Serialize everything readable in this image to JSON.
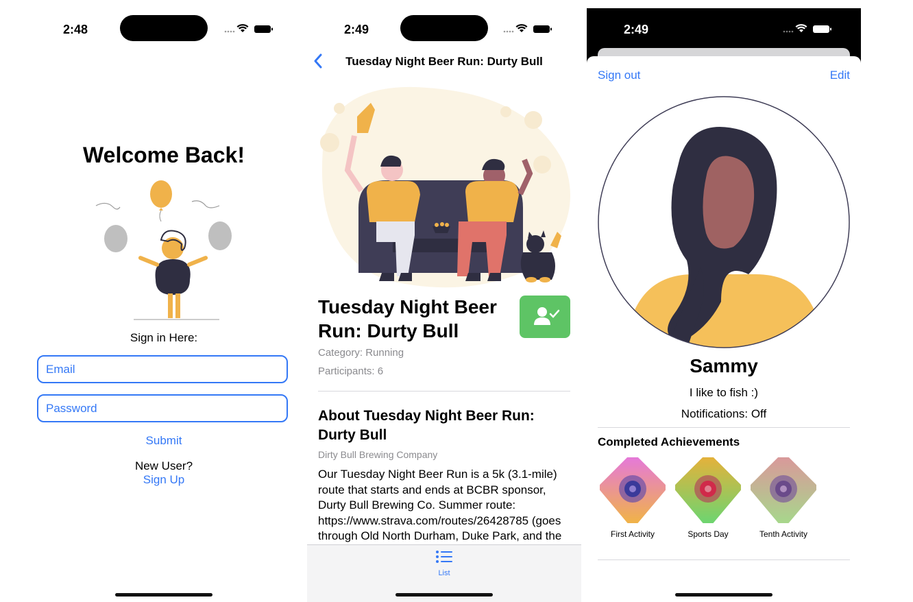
{
  "login": {
    "time": "2:48",
    "heading": "Welcome Back!",
    "sign_in_label": "Sign in Here:",
    "email_placeholder": "Email",
    "password_placeholder": "Password",
    "submit_label": "Submit",
    "new_user_label": "New User?",
    "sign_up_label": "Sign Up"
  },
  "event": {
    "time": "2:49",
    "nav_title": "Tuesday Night Beer Run: Durty Bull",
    "title": "Tuesday Night Beer Run: Durty Bull",
    "category": "Category: Running",
    "participants": "Participants: 6",
    "about_title": "About Tuesday Night Beer Run: Durty Bull",
    "host": "Dirty Bull Brewing Company",
    "description": "Our Tuesday Night Beer Run is a 5k (3.1-mile) route that starts and ends at BCBR sponsor, Durty Bull Brewing Co.  Summer route: https://www.strava.com/routes/26428785 (goes through Old North Durham, Duke Park, and the",
    "tab_list_label": "List"
  },
  "profile": {
    "time": "2:49",
    "sign_out_label": "Sign out",
    "edit_label": "Edit",
    "name": "Sammy",
    "bio": "I like to fish :)",
    "notifications": "Notifications: Off",
    "achievements_title": "Completed Achievements",
    "achievements": [
      {
        "label": "First Activity",
        "color_top": "#e57ad6",
        "color_bottom": "#f0b24a"
      },
      {
        "label": "Sports Day",
        "color_top": "#e2b23c",
        "color_bottom": "#6fd46f"
      },
      {
        "label": "Tenth Activity",
        "color_top": "#d89a9a",
        "color_bottom": "#a8d68c"
      }
    ]
  },
  "colors": {
    "accent": "#3478f6",
    "join_green": "#5ec465",
    "illustration_yellow": "#f0b24a",
    "illustration_dark": "#2f2e41"
  }
}
